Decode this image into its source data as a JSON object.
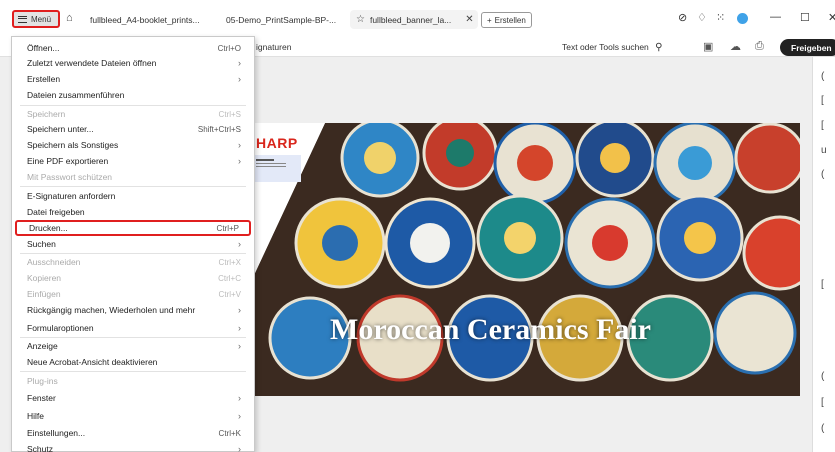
{
  "titlebar": {
    "menu_label": "Menü",
    "tabs": [
      {
        "label": "fullbleed_A4-booklet_prints..."
      },
      {
        "label": "05-Demo_PrintSample-BP-..."
      },
      {
        "label": "fullbleed_banner_la..."
      }
    ],
    "new_tab_label": "Erstellen"
  },
  "toolbar": {
    "signature_text": "ignaturen",
    "search_label": "Text oder Tools suchen",
    "share_label": "Freigeben"
  },
  "document": {
    "brand": "HARP",
    "banner_title": "Moroccan Ceramics Fair"
  },
  "menu": {
    "items": [
      {
        "label": "Öffnen...",
        "shortcut": "Ctrl+O",
        "arrow": "",
        "disabled": false
      },
      {
        "label": "Zuletzt verwendete Dateien öffnen",
        "shortcut": "",
        "arrow": "›",
        "disabled": false
      },
      {
        "label": "Erstellen",
        "shortcut": "",
        "arrow": "›",
        "disabled": false
      },
      {
        "label": "Dateien zusammenführen",
        "shortcut": "",
        "arrow": "",
        "disabled": false
      },
      {
        "label": "Speichern",
        "shortcut": "Ctrl+S",
        "arrow": "",
        "disabled": true
      },
      {
        "label": "Speichern unter...",
        "shortcut": "Shift+Ctrl+S",
        "arrow": "",
        "disabled": false
      },
      {
        "label": "Speichern als Sonstiges",
        "shortcut": "",
        "arrow": "›",
        "disabled": false
      },
      {
        "label": "Eine PDF exportieren",
        "shortcut": "",
        "arrow": "›",
        "disabled": false
      },
      {
        "label": "Mit Passwort schützen",
        "shortcut": "",
        "arrow": "",
        "disabled": true
      },
      {
        "label": "E-Signaturen anfordern",
        "shortcut": "",
        "arrow": "",
        "disabled": false
      },
      {
        "label": "Datei freigeben",
        "shortcut": "",
        "arrow": "",
        "disabled": false
      },
      {
        "label": "Drucken...",
        "shortcut": "Ctrl+P",
        "arrow": "",
        "disabled": false
      },
      {
        "label": "Suchen",
        "shortcut": "",
        "arrow": "›",
        "disabled": false
      },
      {
        "label": "Ausschneiden",
        "shortcut": "Ctrl+X",
        "arrow": "",
        "disabled": true
      },
      {
        "label": "Kopieren",
        "shortcut": "Ctrl+C",
        "arrow": "",
        "disabled": true
      },
      {
        "label": "Einfügen",
        "shortcut": "Ctrl+V",
        "arrow": "",
        "disabled": true
      },
      {
        "label": "Rückgängig machen, Wiederholen und mehr",
        "shortcut": "",
        "arrow": "›",
        "disabled": false
      },
      {
        "label": "Formularoptionen",
        "shortcut": "",
        "arrow": "›",
        "disabled": false
      },
      {
        "label": "Anzeige",
        "shortcut": "",
        "arrow": "›",
        "disabled": false
      },
      {
        "label": "Neue Acrobat-Ansicht deaktivieren",
        "shortcut": "",
        "arrow": "",
        "disabled": false
      },
      {
        "label": "Plug-ins",
        "shortcut": "",
        "arrow": "",
        "disabled": true
      },
      {
        "label": "Fenster",
        "shortcut": "",
        "arrow": "›",
        "disabled": false
      },
      {
        "label": "Hilfe",
        "shortcut": "",
        "arrow": "›",
        "disabled": false
      },
      {
        "label": "Einstellungen...",
        "shortcut": "Ctrl+K",
        "arrow": "",
        "disabled": false
      },
      {
        "label": "Schutz",
        "shortcut": "",
        "arrow": "›",
        "disabled": false
      }
    ]
  },
  "colors": {
    "highlight_border": "#e01f1f",
    "share_button": "#222222",
    "brand_red": "#d9261c"
  }
}
